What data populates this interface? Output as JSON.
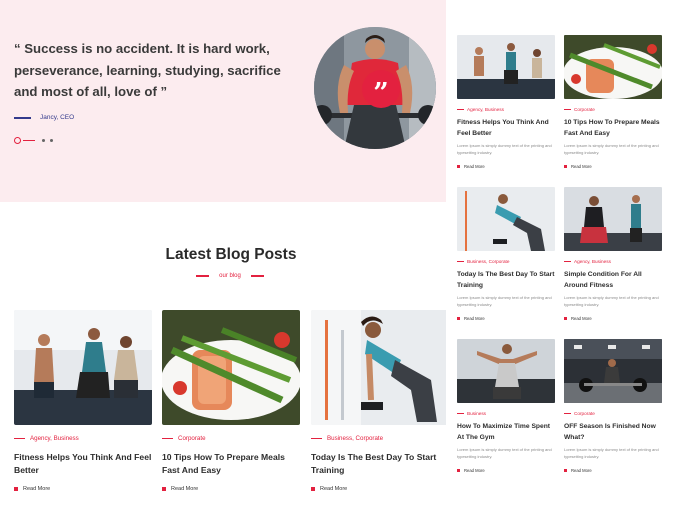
{
  "testimonial": {
    "quote": "“ Success is no accident. It is hard work, perseverance, learning, studying, sacrifice and most of all, love of ”",
    "author": "Jancy, CEO",
    "quote_mark": "”"
  },
  "blog_section": {
    "title": "Latest Blog Posts",
    "subtitle": "our blog"
  },
  "bottom_posts": [
    {
      "category": "Agency, Business",
      "title": "Fitness Helps You Think And Feel Better",
      "read_more": "Read More"
    },
    {
      "category": "Corporate",
      "title": "10 Tips How To Prepare Meals Fast And Easy",
      "read_more": "Read More"
    },
    {
      "category": "Business, Corporate",
      "title": "Today Is The Best Day To Start Training",
      "read_more": "Read More"
    }
  ],
  "grid_posts": [
    {
      "category": "Agency, Business",
      "title": "Fitness Helps You Think And Feel Better",
      "excerpt": "Lorem Ipsum is simply dummy text of the printing and typesetting industry.",
      "read_more": "Read More"
    },
    {
      "category": "Corporate",
      "title": "10 Tips How To Prepare Meals Fast And Easy",
      "excerpt": "Lorem Ipsum is simply dummy text of the printing and typesetting industry.",
      "read_more": "Read More"
    },
    {
      "category": "Business, Corporate",
      "title": "Today Is The Best Day To Start Training",
      "excerpt": "Lorem Ipsum is simply dummy text of the printing and typesetting industry.",
      "read_more": "Read More"
    },
    {
      "category": "Agency, Business",
      "title": "Simple Condition For All Around Fitness",
      "excerpt": "Lorem Ipsum is simply dummy text of the printing and typesetting industry.",
      "read_more": "Read More"
    },
    {
      "category": "Business",
      "title": "How To Maximize Time Spent At The Gym",
      "excerpt": "Lorem Ipsum is simply dummy text of the printing and typesetting industry.",
      "read_more": "Read More"
    },
    {
      "category": "Corporate",
      "title": "OFF Season Is Finished Now What?",
      "excerpt": "Lorem Ipsum is simply dummy text of the printing and typesetting industry.",
      "read_more": "Read More"
    }
  ],
  "colors": {
    "accent": "#e3213f",
    "testimonial_bg": "#fcecef",
    "author": "#333a8c"
  },
  "icons": [
    "quote-icon",
    "carousel-dot-icon"
  ]
}
